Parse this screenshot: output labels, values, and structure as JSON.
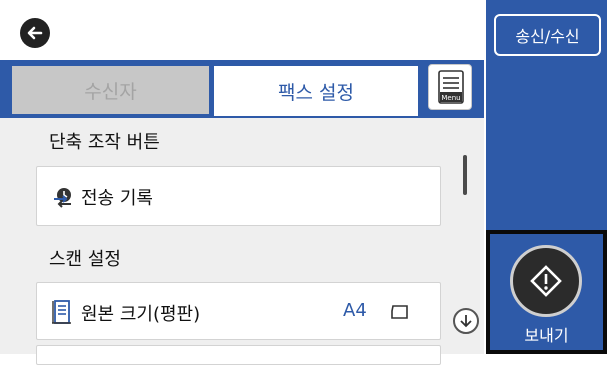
{
  "header": {
    "back_icon": "back-arrow-icon"
  },
  "tabs": {
    "recipient_label": "수신자",
    "fax_settings_label": "팩스 설정",
    "menu_icon_text": "Menu"
  },
  "shortcuts": {
    "title": "단축 조작 버튼",
    "history_label": "전송 기록"
  },
  "scan": {
    "title": "스캔 설정",
    "original_size_label": "원본 크기(평판)",
    "original_size_value": "A4"
  },
  "side": {
    "send_receive_label": "송신/수신",
    "send_label": "보내기"
  },
  "colors": {
    "accent_blue": "#2e5aa8",
    "dark": "#222222"
  }
}
